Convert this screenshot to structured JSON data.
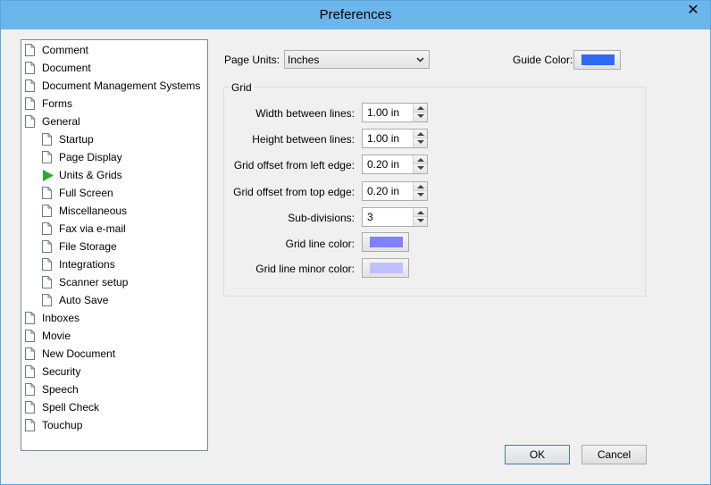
{
  "window": {
    "title": "Preferences",
    "close_glyph": "✕"
  },
  "tree": {
    "items": [
      {
        "label": "Comment",
        "level": 0,
        "icon": "document-icon"
      },
      {
        "label": "Document",
        "level": 0,
        "icon": "document-icon"
      },
      {
        "label": "Document Management Systems",
        "level": 0,
        "icon": "document-icon"
      },
      {
        "label": "Forms",
        "level": 0,
        "icon": "document-icon"
      },
      {
        "label": "General",
        "level": 0,
        "icon": "document-icon"
      },
      {
        "label": "Startup",
        "level": 1,
        "icon": "document-icon"
      },
      {
        "label": "Page Display",
        "level": 1,
        "icon": "document-icon"
      },
      {
        "label": "Units & Grids",
        "level": 1,
        "icon": "selected-arrow-icon",
        "selected": true
      },
      {
        "label": "Full Screen",
        "level": 1,
        "icon": "document-icon"
      },
      {
        "label": "Miscellaneous",
        "level": 1,
        "icon": "document-icon"
      },
      {
        "label": "Fax via e-mail",
        "level": 1,
        "icon": "document-icon"
      },
      {
        "label": "File Storage",
        "level": 1,
        "icon": "document-icon"
      },
      {
        "label": "Integrations",
        "level": 1,
        "icon": "document-icon"
      },
      {
        "label": "Scanner setup",
        "level": 1,
        "icon": "document-icon"
      },
      {
        "label": "Auto Save",
        "level": 1,
        "icon": "document-icon"
      },
      {
        "label": "Inboxes",
        "level": 0,
        "icon": "document-icon"
      },
      {
        "label": "Movie",
        "level": 0,
        "icon": "document-icon"
      },
      {
        "label": "New Document",
        "level": 0,
        "icon": "document-icon"
      },
      {
        "label": "Security",
        "level": 0,
        "icon": "document-icon"
      },
      {
        "label": "Speech",
        "level": 0,
        "icon": "document-icon"
      },
      {
        "label": "Spell Check",
        "level": 0,
        "icon": "document-icon"
      },
      {
        "label": "Touchup",
        "level": 0,
        "icon": "document-icon"
      }
    ]
  },
  "units": {
    "page_units_label": "Page Units:",
    "page_units_value": "Inches",
    "guide_color_label": "Guide Color:",
    "guide_color": "#2f6bf0"
  },
  "grid": {
    "title": "Grid",
    "width_label": "Width between lines:",
    "width_value": "1.00 in",
    "height_label": "Height between lines:",
    "height_value": "1.00 in",
    "offset_left_label": "Grid offset from left edge:",
    "offset_left_value": "0.20 in",
    "offset_top_label": "Grid offset from top edge:",
    "offset_top_value": "0.20 in",
    "subdiv_label": "Sub-divisions:",
    "subdiv_value": "3",
    "line_color_label": "Grid line color:",
    "line_color": "#8080ff",
    "minor_color_label": "Grid line minor color:",
    "minor_color": "#c0c0ff"
  },
  "buttons": {
    "ok": "OK",
    "cancel": "Cancel"
  },
  "colors": {
    "titlebar": "#6cb6ec",
    "selected_arrow": "#2fa82f"
  }
}
